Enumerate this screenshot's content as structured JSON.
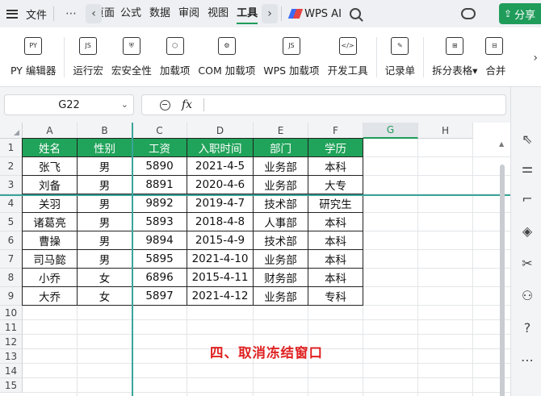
{
  "menubar": {
    "file": "文件",
    "more": "⋯",
    "tabs": [
      "页面",
      "公式",
      "数据",
      "审阅",
      "视图",
      "工具"
    ],
    "active_tab": "工具",
    "wps_ai": "WPS AI",
    "share": "分享"
  },
  "ribbon": {
    "items": [
      {
        "label": "PY 编辑器",
        "icon": "python-editor-icon",
        "glyph": "PY"
      },
      {
        "label": "运行宏",
        "icon": "run-macro-icon",
        "glyph": "JS"
      },
      {
        "label": "宏安全性",
        "icon": "macro-security-icon",
        "glyph": "⛨"
      },
      {
        "label": "加载项",
        "icon": "addins-icon",
        "glyph": "⬡"
      },
      {
        "label": "COM 加载项",
        "icon": "com-addins-icon",
        "glyph": "⚙"
      },
      {
        "label": "WPS 加载项",
        "icon": "wps-addins-icon",
        "glyph": "JS"
      },
      {
        "label": "开发工具",
        "icon": "developer-tools-icon",
        "glyph": "</>"
      },
      {
        "label": "记录单",
        "icon": "record-form-icon",
        "glyph": "✎"
      },
      {
        "label": "拆分表格",
        "icon": "split-table-icon",
        "glyph": "⊞"
      },
      {
        "label": "合并",
        "icon": "merge-table-icon",
        "glyph": "⊟"
      }
    ]
  },
  "formula_bar": {
    "name_box": "G22",
    "fx": "fx",
    "value": ""
  },
  "sheet": {
    "columns": [
      "A",
      "B",
      "C",
      "D",
      "E",
      "F",
      "G",
      "H"
    ],
    "selected_column": "G",
    "rows": [
      "1",
      "2",
      "3",
      "4",
      "5",
      "6",
      "7",
      "8",
      "9",
      "10",
      "11",
      "12",
      "13",
      "14",
      "15"
    ],
    "table": {
      "headers": [
        "姓名",
        "性别",
        "工资",
        "入职时间",
        "部门",
        "学历"
      ],
      "rows": [
        [
          "张飞",
          "男",
          "5890",
          "2021-4-5",
          "业务部",
          "本科"
        ],
        [
          "刘备",
          "男",
          "8891",
          "2020-4-6",
          "业务部",
          "大专"
        ],
        [
          "关羽",
          "男",
          "9892",
          "2019-4-7",
          "技术部",
          "研究生"
        ],
        [
          "诸葛亮",
          "男",
          "5893",
          "2018-4-8",
          "人事部",
          "本科"
        ],
        [
          "曹操",
          "男",
          "9894",
          "2015-4-9",
          "技术部",
          "本科"
        ],
        [
          "司马懿",
          "男",
          "5895",
          "2021-4-10",
          "业务部",
          "本科"
        ],
        [
          "小乔",
          "女",
          "6896",
          "2015-4-11",
          "财务部",
          "本科"
        ],
        [
          "大乔",
          "女",
          "5897",
          "2021-4-12",
          "业务部",
          "专科"
        ]
      ]
    },
    "caption": "四、取消冻结窗口",
    "colors": {
      "header_green": "#20a35a",
      "caption_red": "#e02020",
      "freeze_line": "#3aa59a"
    }
  },
  "sidebar": {
    "icons": [
      "select-icon",
      "adjust-icon",
      "crop-icon",
      "ai-icon",
      "tools-icon",
      "style-icon",
      "help-icon",
      "more-icon"
    ]
  }
}
